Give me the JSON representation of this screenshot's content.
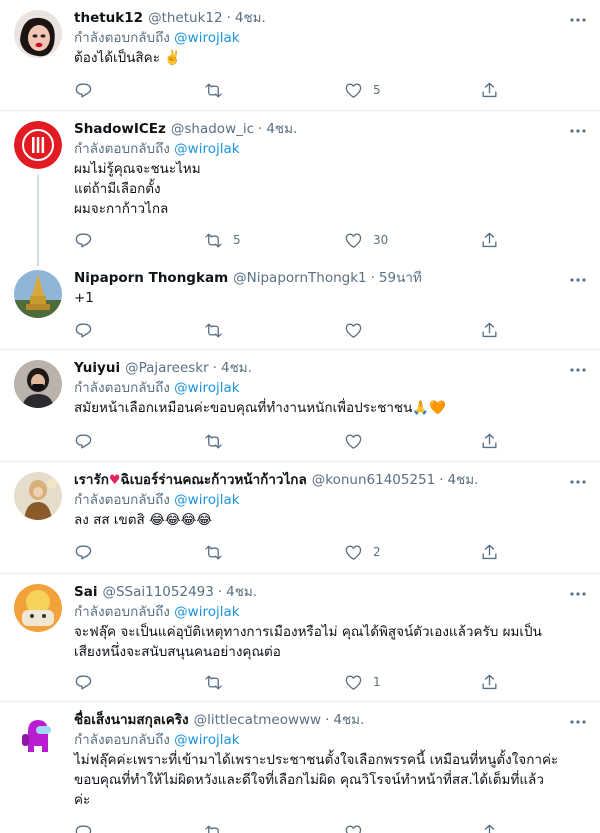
{
  "colors": {
    "link": "#1b95e0",
    "muted": "#5b7083",
    "text": "#0f1419",
    "divider": "#ebeef0"
  },
  "tweets": [
    {
      "name": "thetuk12",
      "handle": "@thetuk12",
      "time": "4ชม.",
      "reply_prefix": "กำลังตอบกลับถึง",
      "reply_to": "@wirojlak",
      "lines": [
        "ต้องได้เป็นสิคะ ✌️"
      ],
      "replies": "",
      "retweets": "",
      "likes": "5"
    },
    {
      "name": "ShadowICEz",
      "handle": "@shadow_ic",
      "time": "4ชม.",
      "reply_prefix": "กำลังตอบกลับถึง",
      "reply_to": "@wirojlak",
      "lines": [
        "ผมไม่รู้คุณจะชนะไหม",
        "แต่ถ้ามีเลือกตั้ง",
        "ผมจะกาก้าวไกล"
      ],
      "replies": "",
      "retweets": "5",
      "likes": "30"
    },
    {
      "name": "Nipaporn Thongkam",
      "handle": "@NipapornThongk1",
      "time": "59นาที",
      "reply_prefix": "",
      "reply_to": "",
      "lines": [
        "+1"
      ],
      "replies": "",
      "retweets": "",
      "likes": ""
    },
    {
      "name": "Yuiyui",
      "handle": "@Pajareeskr",
      "time": "4ชม.",
      "reply_prefix": "กำลังตอบกลับถึง",
      "reply_to": "@wirojlak",
      "lines": [
        "สมัยหน้าเลือกเหมือนค่ะขอบคุณที่ทำงานหนักเพื่อประชาชน🙏🧡"
      ],
      "replies": "",
      "retweets": "",
      "likes": ""
    },
    {
      "name_pre": "เรารัก",
      "name_heart": "♥",
      "name_post": "ฉิเบอร์ร่านคณะก้าวหน้าก้าวไกล",
      "handle": "@konun61405251",
      "time": "4ชม.",
      "reply_prefix": "กำลังตอบกลับถึง",
      "reply_to": "@wirojlak",
      "lines": [
        "ลง สส เขตสิ 😂😂😂😂"
      ],
      "replies": "",
      "retweets": "",
      "likes": "2"
    },
    {
      "name": "Sai",
      "handle": "@SSai11052493",
      "time": "4ชม.",
      "reply_prefix": "กำลังตอบกลับถึง",
      "reply_to": "@wirojlak",
      "lines": [
        "จะฟลุ๊ค จะเป็นแค่อุบัติเหตุทางการเมืองหรือไม่ คุณได้พิสูจน์ตัวเองแล้วครับ ผมเป็น",
        "เสียงหนึ่งจะสนับสนุนคนอย่างคุณต่อ"
      ],
      "replies": "",
      "retweets": "",
      "likes": "1"
    },
    {
      "name": "ชื่อเส็งนามสกุลเคริง",
      "handle": "@littlecatmeowww",
      "time": "4ชม.",
      "reply_prefix": "กำลังตอบกลับถึง",
      "reply_to": "@wirojlak",
      "lines": [
        "ไม่ฟลุ๊คค่ะเพราะที่เข้ามาได้เพราะประชาชนตั้งใจเลือกพรรคนี้ เหมือนที่หนูตั้งใจกาค่ะ",
        "ขอบคุณที่ทำให้ไม่ผิดหวังและดีใจที่เลือกไม่ผิด คุณวิโรจน์ทำหน้าที่สส.ได้เต็มที่แล้ว",
        "ค่ะ"
      ],
      "replies": "",
      "retweets": "",
      "likes": ""
    }
  ]
}
